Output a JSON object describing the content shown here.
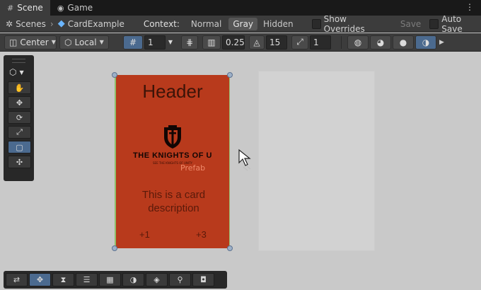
{
  "tabs": [
    {
      "label": "Scene",
      "icon": "grid-icon",
      "active": true
    },
    {
      "label": "Game",
      "icon": "gamepad-icon",
      "active": false
    }
  ],
  "window_menu_icon": "kebab-menu-icon",
  "breadcrumb": {
    "root": "Scenes",
    "current": "CardExample"
  },
  "context": {
    "label": "Context:",
    "options": [
      "Normal",
      "Gray",
      "Hidden"
    ],
    "selected": "Gray"
  },
  "show_overrides_label": "Show Overrides",
  "save_label": "Save",
  "auto_save_label": "Auto Save",
  "toolbar": {
    "pivot_mode": "Center",
    "pivot_rotation": "Local",
    "grid_size": "1",
    "snap_increment": "0.25",
    "rotate_snap": "15",
    "scale_snap": "1"
  },
  "card": {
    "header": "Header",
    "logo_text": "THE KNIGHTS OF U",
    "logo_subtext": "SEE THE KNIGHTS OF UNITY",
    "prefab_label": "Prefab",
    "description": "This is a card description",
    "stat_left": "+1",
    "stat_right": "+3",
    "color": "#b83a1c"
  },
  "colors": {
    "accent_active": "#4b6a8f",
    "panel": "#3c3c3c",
    "viewport_bg": "#c9c9c9"
  }
}
